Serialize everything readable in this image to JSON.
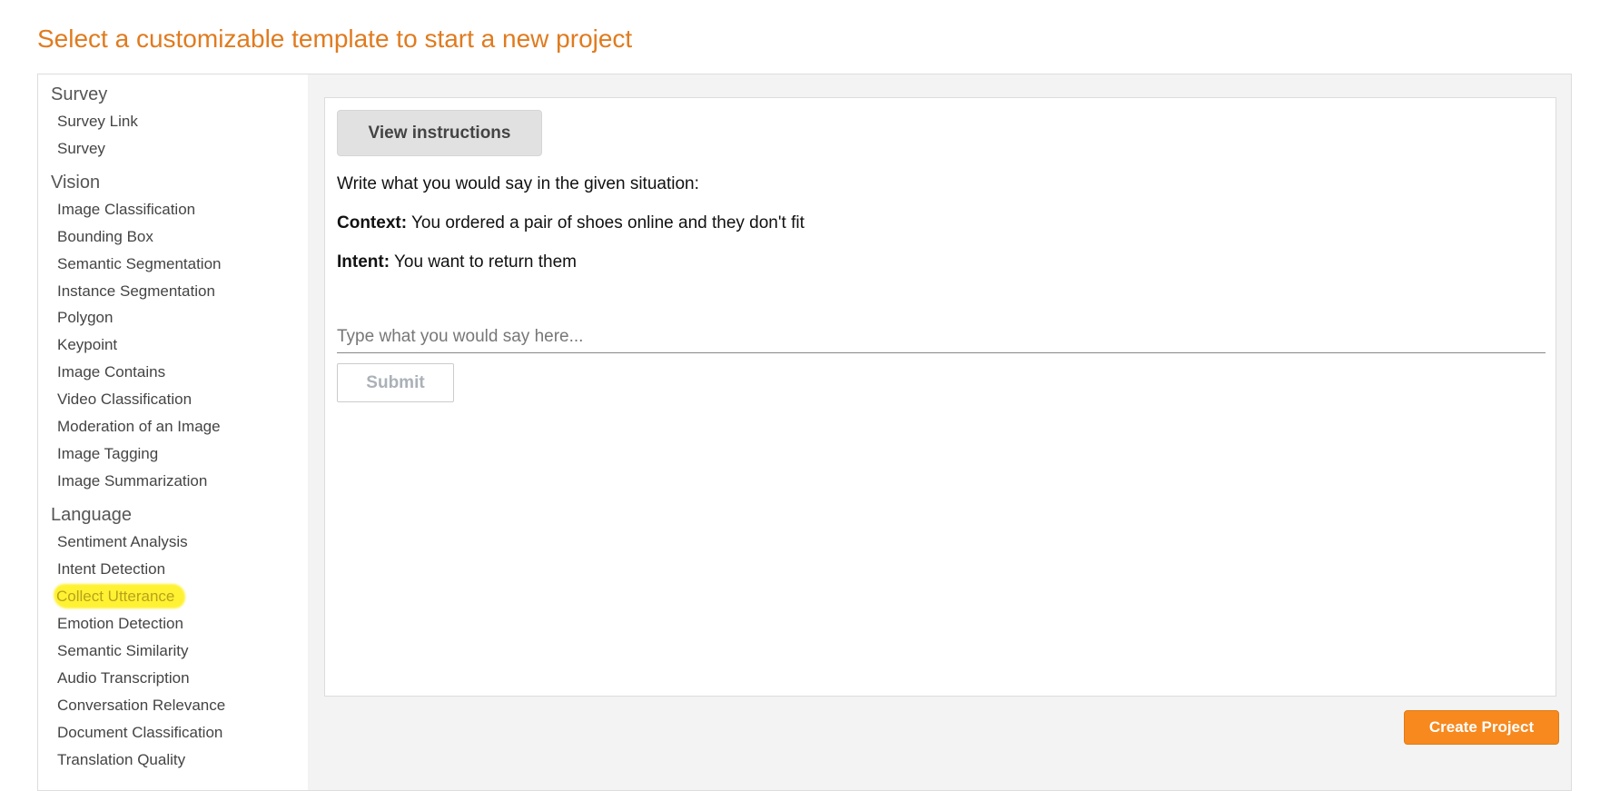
{
  "page": {
    "title": "Select a customizable template to start a new project"
  },
  "sidebar": {
    "groups": [
      {
        "label": "Survey",
        "items": [
          "Survey Link",
          "Survey"
        ]
      },
      {
        "label": "Vision",
        "items": [
          "Image Classification",
          "Bounding Box",
          "Semantic Segmentation",
          "Instance Segmentation",
          "Polygon",
          "Keypoint",
          "Image Contains",
          "Video Classification",
          "Moderation of an Image",
          "Image Tagging",
          "Image Summarization"
        ]
      },
      {
        "label": "Language",
        "items": [
          "Sentiment Analysis",
          "Intent Detection",
          "Collect Utterance",
          "Emotion Detection",
          "Semantic Similarity",
          "Audio Transcription",
          "Conversation Relevance",
          "Document Classification",
          "Translation Quality"
        ]
      }
    ],
    "highlighted_item": "Collect Utterance",
    "highlight_color": "#fff233"
  },
  "preview": {
    "view_instructions_label": "View instructions",
    "instruction_text": "Write what you would say in the given situation:",
    "context_label": "Context:",
    "context_text": " You ordered a pair of shoes online and they don't fit",
    "intent_label": "Intent:",
    "intent_text": " You want to return them",
    "input_value": "",
    "input_placeholder": "Type what you would say here...",
    "submit_label": "Submit"
  },
  "footer": {
    "create_project_label": "Create Project"
  },
  "colors": {
    "title": "#e07b1f",
    "create_button": "#f7891e",
    "highlight": "#fff233"
  }
}
